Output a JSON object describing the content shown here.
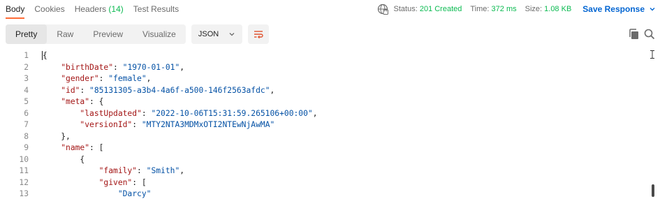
{
  "tabs": {
    "body": "Body",
    "cookies": "Cookies",
    "headers": "Headers",
    "headers_count": "(14)",
    "test_results": "Test Results"
  },
  "status": {
    "status_label": "Status:",
    "status_value": "201 Created",
    "time_label": "Time:",
    "time_value": "372 ms",
    "size_label": "Size:",
    "size_value": "1.08 KB",
    "save_response": "Save Response"
  },
  "toolbar": {
    "pretty": "Pretty",
    "raw": "Raw",
    "preview": "Preview",
    "visualize": "Visualize",
    "format": "JSON"
  },
  "editor": {
    "line_numbers": [
      "1",
      "2",
      "3",
      "4",
      "5",
      "6",
      "7",
      "8",
      "9",
      "10",
      "11",
      "12",
      "13"
    ],
    "lines": [
      {
        "ind": "",
        "k": "",
        "v": "{"
      },
      {
        "ind": "    ",
        "k": "\"birthDate\"",
        "sep": ": ",
        "s": "\"1970-01-01\"",
        "end": ","
      },
      {
        "ind": "    ",
        "k": "\"gender\"",
        "sep": ": ",
        "s": "\"female\"",
        "end": ","
      },
      {
        "ind": "    ",
        "k": "\"id\"",
        "sep": ": ",
        "s": "\"85131305-a3b4-4a6f-a500-146f2563afdc\"",
        "end": ","
      },
      {
        "ind": "    ",
        "k": "\"meta\"",
        "sep": ": ",
        "s": "",
        "end": "{"
      },
      {
        "ind": "        ",
        "k": "\"lastUpdated\"",
        "sep": ": ",
        "s": "\"2022-10-06T15:31:59.265106+00:00\"",
        "end": ","
      },
      {
        "ind": "        ",
        "k": "\"versionId\"",
        "sep": ": ",
        "s": "\"MTY2NTA3MDMxOTI2NTEwNjAwMA\"",
        "end": ""
      },
      {
        "ind": "    ",
        "k": "",
        "v": "},"
      },
      {
        "ind": "    ",
        "k": "\"name\"",
        "sep": ": ",
        "s": "",
        "end": "["
      },
      {
        "ind": "        ",
        "k": "",
        "v": "{"
      },
      {
        "ind": "            ",
        "k": "\"family\"",
        "sep": ": ",
        "s": "\"Smith\"",
        "end": ","
      },
      {
        "ind": "            ",
        "k": "\"given\"",
        "sep": ": ",
        "s": "",
        "end": "["
      },
      {
        "ind": "                ",
        "k": "",
        "s": "\"Darcy\"",
        "end": ""
      }
    ]
  },
  "colors": {
    "accent_tab": "#ff6c37",
    "status_green": "#0cbb52",
    "link_blue": "#0265d2",
    "json_key": "#a31515",
    "json_string": "#0451a5"
  },
  "icons": [
    "globe-icon",
    "chevron-down-icon",
    "wrap-lines-icon",
    "copy-icon",
    "search-icon"
  ]
}
